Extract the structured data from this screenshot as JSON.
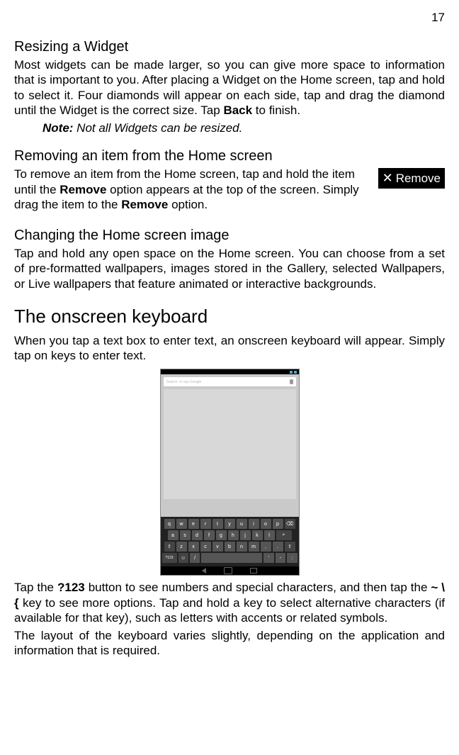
{
  "page": {
    "number": "17"
  },
  "s1": {
    "heading": "Resizing a Widget",
    "para_a": "Most widgets can be made larger, so you can give more space to information that is important to you. After placing a Widget on the Home screen, tap and hold to select it. Four diamonds will appear on each side, tap and drag the diamond until the Widget is the correct size. Tap ",
    "back": "Back",
    "para_b": " to finish.",
    "note_label": "Note:",
    "note": " Not all Widgets can be resized."
  },
  "s2": {
    "heading": "Removing an item from the Home screen",
    "para_a": "To remove an item from the Home screen, tap and hold the item until the ",
    "remove1": "Remove",
    "para_b": " option appears at the top of the screen. Simply drag the item to the ",
    "remove2": "Remove",
    "para_c": " option.",
    "button_label": "Remove"
  },
  "s3": {
    "heading": "Changing the Home screen image",
    "para": "Tap and hold any open space on the Home screen. You can choose from a set of pre-formatted wallpapers, images stored in the Gallery, selected Wallpapers, or Live wallpapers that feature animated or interactive backgrounds."
  },
  "s4": {
    "heading": "The onscreen keyboard",
    "para1": "When you tap a text box to enter text, an onscreen keyboard will appear. Simply tap on keys to enter text.",
    "para2_a": "Tap the ",
    "key123": "?123",
    "para2_b": " button to see numbers and special characters, and then tap the ",
    "keytilde": "~ \\ {",
    "para2_c": " key to see more options. Tap and hold a key to select alternative characters (if available for that key), such as letters with accents or related symbols.",
    "para3": "The layout of the keyboard varies slightly, depending on the application and information that is required."
  },
  "kb": {
    "placeholder": "Search, or say Google",
    "row1": [
      "q",
      "w",
      "e",
      "r",
      "t",
      "y",
      "u",
      "i",
      "o",
      "p",
      "⌫"
    ],
    "row2": [
      "a",
      "s",
      "d",
      "f",
      "g",
      "h",
      "j",
      "k",
      "l"
    ],
    "row3": [
      "⇧",
      "z",
      "x",
      "c",
      "v",
      "b",
      "n",
      "m",
      ",",
      ".",
      "⇧"
    ],
    "row4": [
      "?123",
      "☺",
      "/",
      " ",
      "'",
      "-",
      ":"
    ]
  }
}
